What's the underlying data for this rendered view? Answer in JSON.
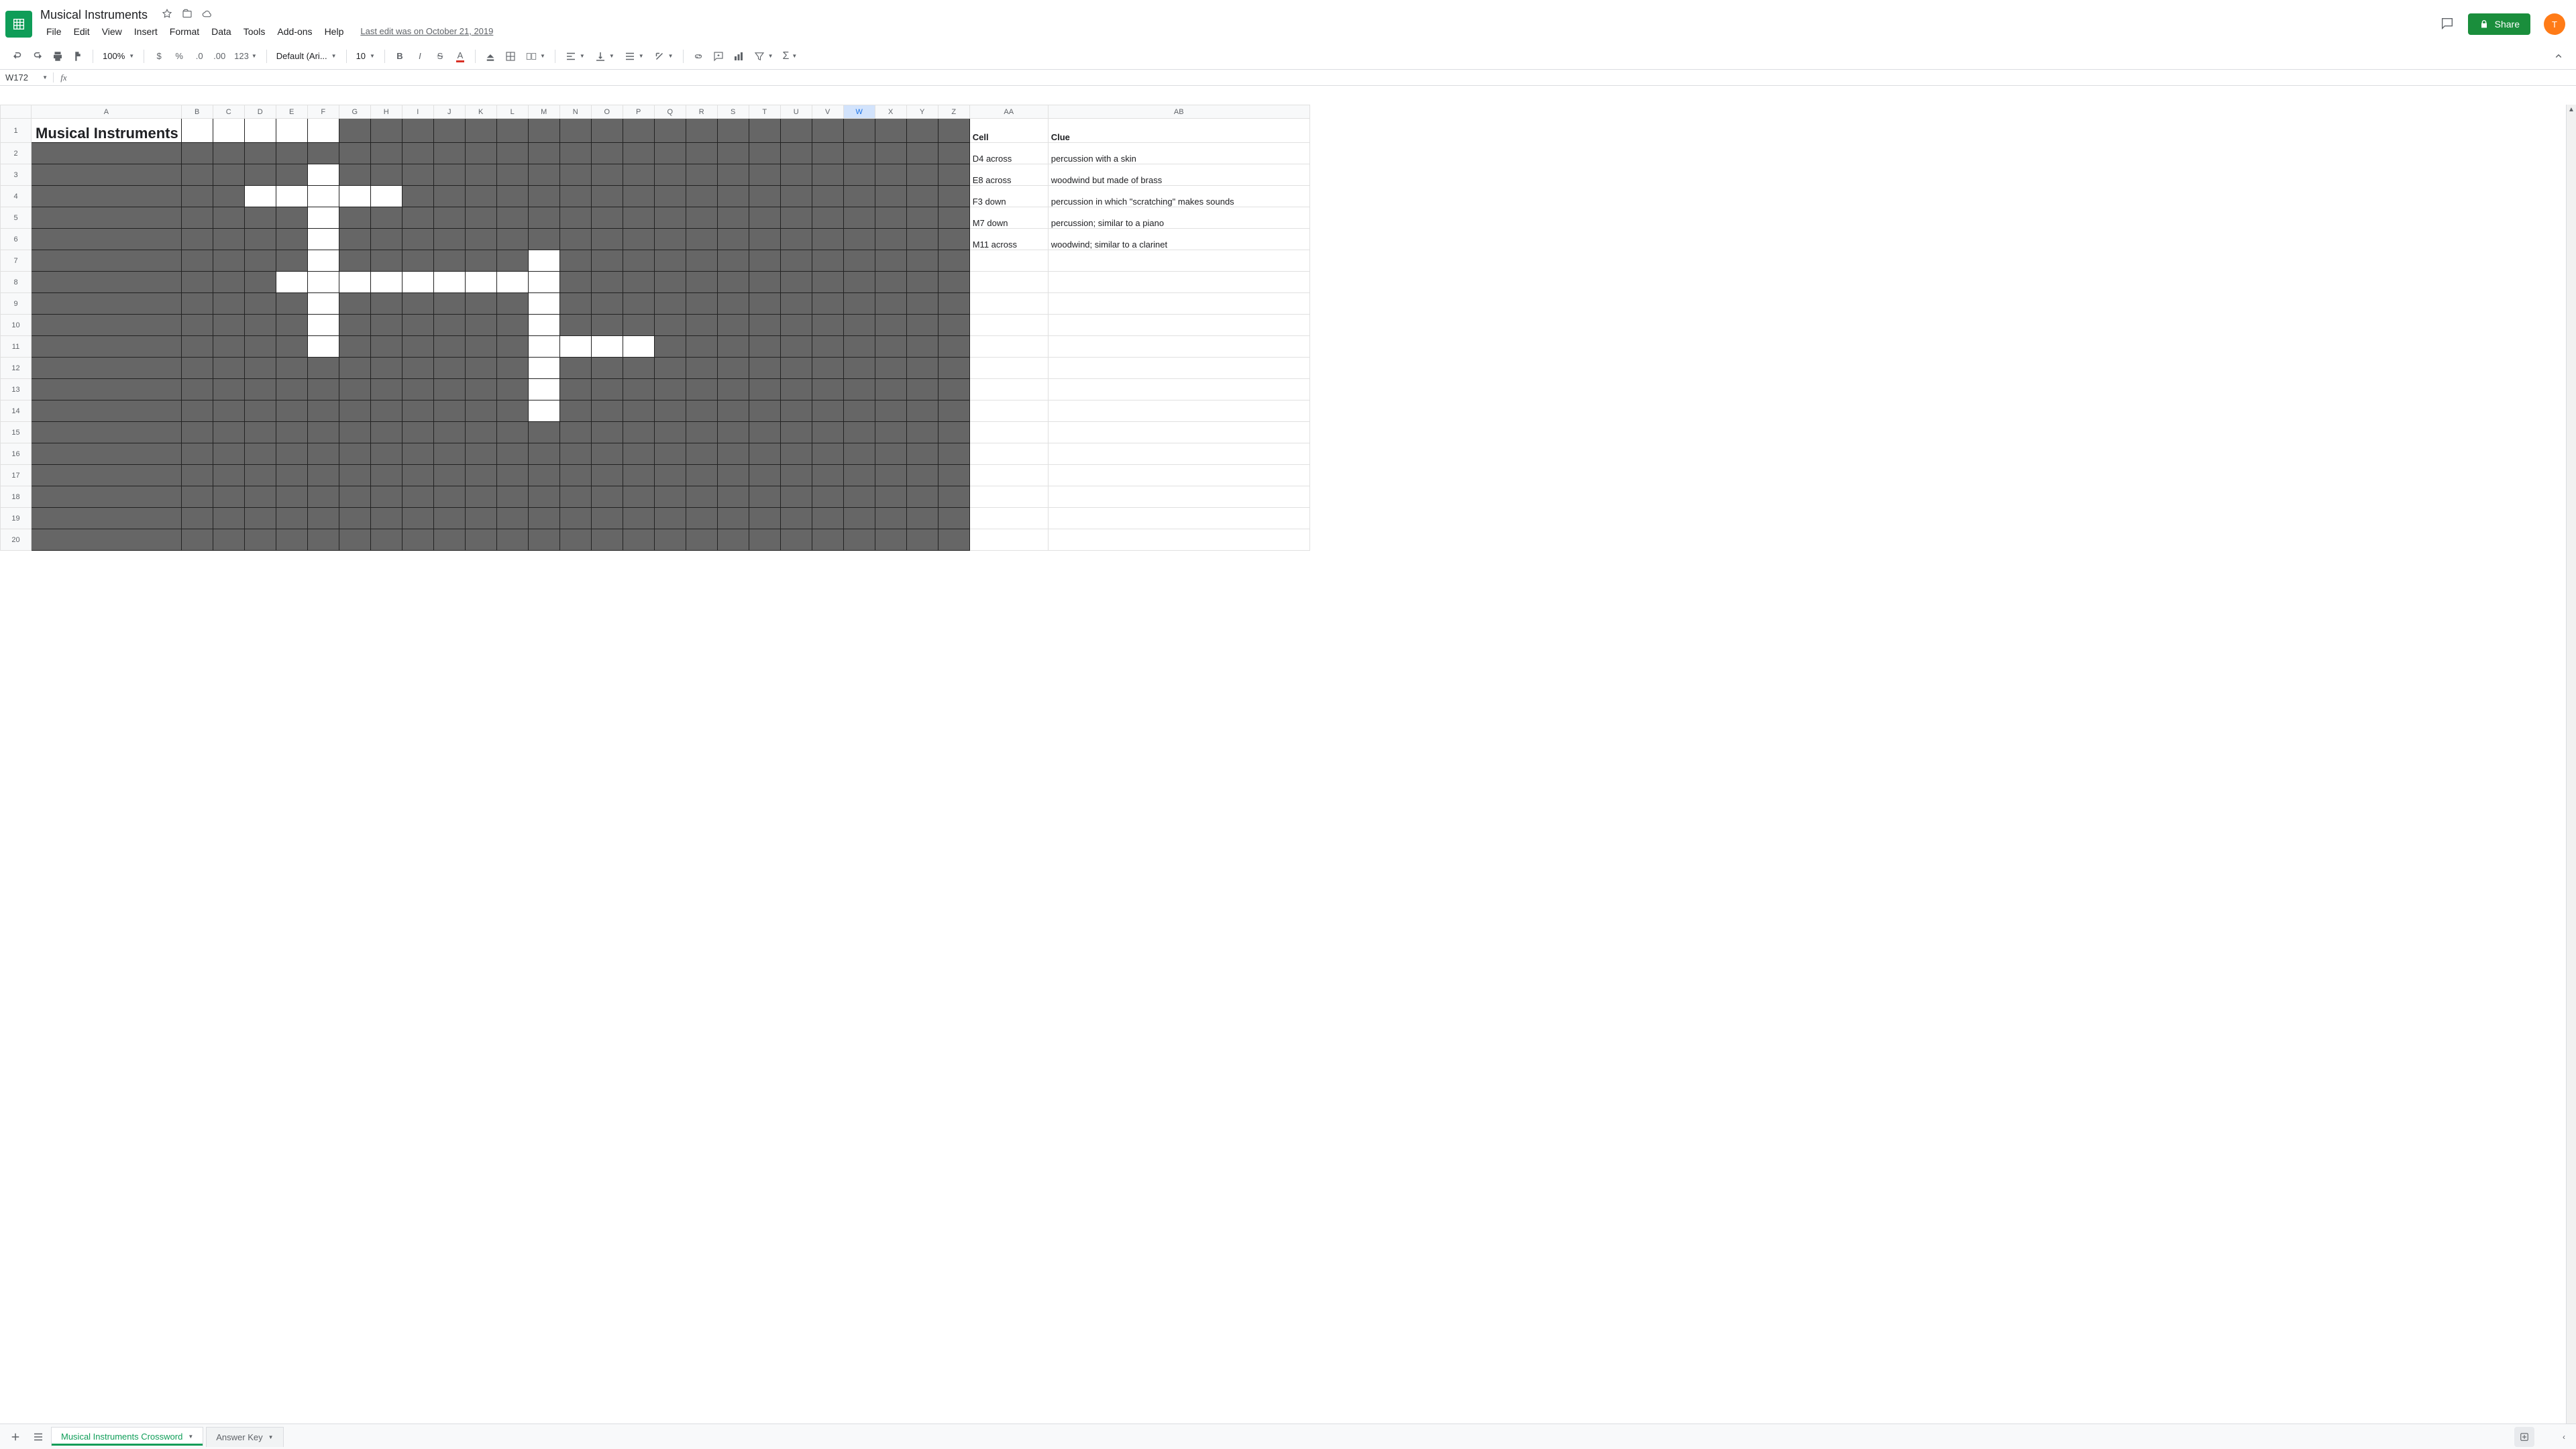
{
  "doc_title": "Musical Instruments",
  "menus": [
    "File",
    "Edit",
    "View",
    "Insert",
    "Format",
    "Data",
    "Tools",
    "Add-ons",
    "Help"
  ],
  "last_edit": "Last edit was on October 21, 2019",
  "share_label": "Share",
  "avatar_letter": "T",
  "toolbar": {
    "zoom": "100%",
    "currency_fmt": "$",
    "percent_fmt": "%",
    "dec_dec": ".0",
    "inc_dec": ".00",
    "more_fmt": "123",
    "font": "Default (Ari...",
    "size": "10"
  },
  "name_box": "W172",
  "columns": [
    "A",
    "B",
    "C",
    "D",
    "E",
    "F",
    "G",
    "H",
    "I",
    "J",
    "K",
    "L",
    "M",
    "N",
    "O",
    "P",
    "Q",
    "R",
    "S",
    "T",
    "U",
    "V",
    "W",
    "X",
    "Y",
    "Z",
    "AA",
    "AB"
  ],
  "selected_col": "W",
  "row_count": 20,
  "crossword": {
    "title": "Musical Instruments",
    "grid_cols": [
      "A",
      "B",
      "C",
      "D",
      "E",
      "F",
      "G",
      "H",
      "I",
      "J",
      "K",
      "L",
      "M",
      "N",
      "O",
      "P",
      "Q",
      "R",
      "S",
      "T",
      "U",
      "V",
      "W",
      "X",
      "Y",
      "Z"
    ],
    "white_cells": [
      "F3",
      "D4",
      "E4",
      "F4",
      "G4",
      "H4",
      "F5",
      "F6",
      "F7",
      "M7",
      "E8",
      "F8",
      "G8",
      "H8",
      "I8",
      "J8",
      "K8",
      "L8",
      "M8",
      "F9",
      "M9",
      "F10",
      "M10",
      "F11",
      "M11",
      "N11",
      "O11",
      "P11",
      "M12",
      "M13",
      "M14"
    ]
  },
  "clue_header": {
    "cell": "Cell",
    "clue": "Clue"
  },
  "clues": [
    {
      "cell": "D4 across",
      "clue": "percussion with a skin"
    },
    {
      "cell": "E8 across",
      "clue": "woodwind but made of brass"
    },
    {
      "cell": "F3 down",
      "clue": "percussion in which \"scratching\" makes sounds"
    },
    {
      "cell": "M7 down",
      "clue": "percussion; similar to a piano"
    },
    {
      "cell": "M11 across",
      "clue": "woodwind; similar to a clarinet"
    }
  ],
  "tabs": {
    "active": "Musical Instruments Crossword",
    "inactive": "Answer Key"
  }
}
